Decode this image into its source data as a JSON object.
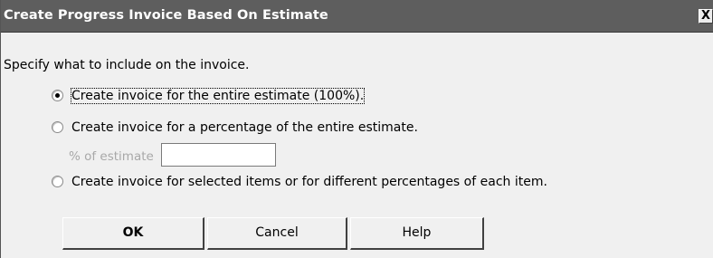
{
  "dialog": {
    "title": "Create Progress Invoice Based On Estimate",
    "close_label": "X",
    "instruction": "Specify what to include on the invoice."
  },
  "options": [
    {
      "label": "Create invoice for the entire estimate (100%).",
      "selected": true
    },
    {
      "label": "Create invoice for a percentage of the entire estimate.",
      "selected": false
    },
    {
      "label": "Create invoice for selected items or for different percentages of each item.",
      "selected": false
    }
  ],
  "percentage": {
    "label": "% of estimate",
    "value": ""
  },
  "buttons": {
    "ok": "OK",
    "cancel": "Cancel",
    "help": "Help"
  }
}
